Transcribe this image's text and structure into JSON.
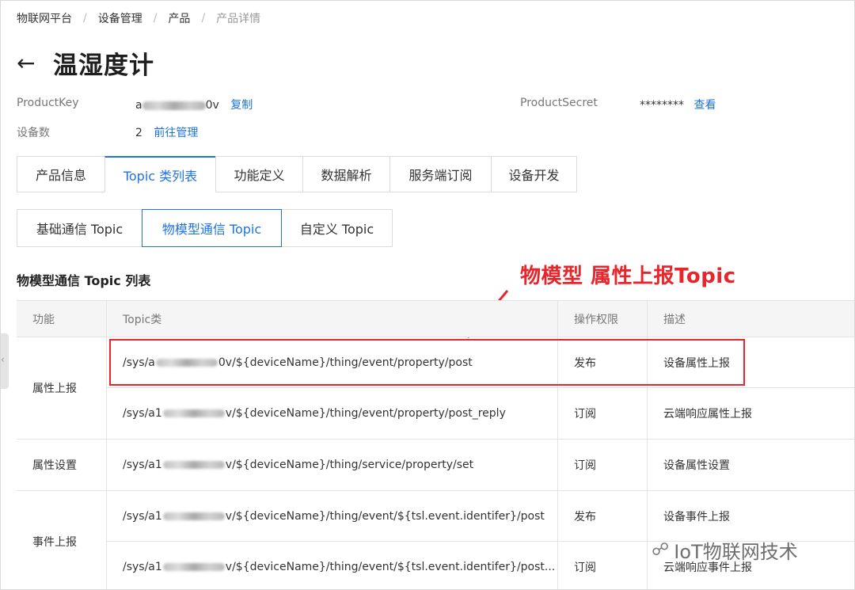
{
  "breadcrumb": [
    "物联网平台",
    "设备管理",
    "产品",
    "产品详情"
  ],
  "title": "温湿度计",
  "product_key": {
    "label": "ProductKey",
    "value_prefix": "a",
    "value_suffix": "0v",
    "copy_link": "复制"
  },
  "product_secret": {
    "label": "ProductSecret",
    "value": "********",
    "view_link": "查看"
  },
  "device_count": {
    "label": "设备数",
    "value": "2",
    "manage_link": "前往管理"
  },
  "tabs": [
    "产品信息",
    "Topic 类列表",
    "功能定义",
    "数据解析",
    "服务端订阅",
    "设备开发"
  ],
  "active_tab": 1,
  "subtabs": [
    "基础通信 Topic",
    "物模型通信 Topic",
    "自定义 Topic"
  ],
  "active_subtab": 1,
  "section_title": "物模型通信 Topic 列表",
  "annotation": "物模型 属性上报Topic",
  "table": {
    "headers": [
      "功能",
      "Topic类",
      "操作权限",
      "描述"
    ],
    "groups": [
      {
        "func": "属性上报",
        "rows": [
          {
            "topic_prefix": "/sys/a",
            "topic_suffix": "0v/${deviceName}/thing/event/property/post",
            "perm": "发布",
            "desc": "设备属性上报"
          },
          {
            "topic_prefix": "/sys/a1",
            "topic_suffix": "v/${deviceName}/thing/event/property/post_reply",
            "perm": "订阅",
            "desc": "云端响应属性上报"
          }
        ]
      },
      {
        "func": "属性设置",
        "rows": [
          {
            "topic_prefix": "/sys/a1",
            "topic_suffix": "v/${deviceName}/thing/service/property/set",
            "perm": "订阅",
            "desc": "设备属性设置"
          }
        ]
      },
      {
        "func": "事件上报",
        "rows": [
          {
            "topic_prefix": "/sys/a1",
            "topic_suffix": "v/${deviceName}/thing/event/${tsl.event.identifer}/post",
            "perm": "发布",
            "desc": "设备事件上报"
          },
          {
            "topic_prefix": "/sys/a1",
            "topic_suffix": "v/${deviceName}/thing/event/${tsl.event.identifer}/post...",
            "perm": "订阅",
            "desc": "云端响应事件上报"
          }
        ]
      }
    ]
  },
  "watermark": "IoT物联网技术",
  "colors": {
    "link": "#1e73e0",
    "annotation": "#e8252b"
  }
}
